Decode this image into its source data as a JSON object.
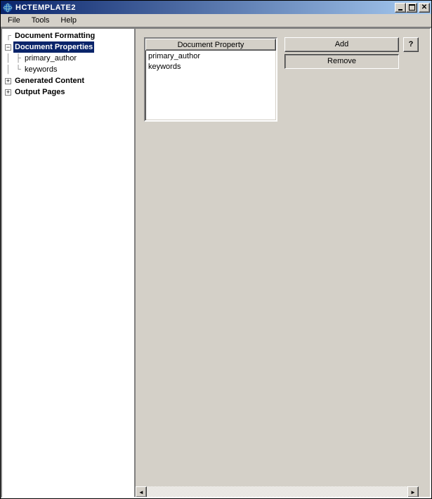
{
  "window": {
    "title": "HCTEMPLATE2"
  },
  "menubar": {
    "file": "File",
    "tools": "Tools",
    "help": "Help"
  },
  "tree": {
    "root1": "Document Formatting",
    "root2": "Document Properties",
    "child2a": "primary_author",
    "child2b": "keywords",
    "root3": "Generated Content",
    "root4": "Output Pages"
  },
  "list": {
    "header": "Document Property",
    "rows": [
      "primary_author",
      "keywords"
    ]
  },
  "buttons": {
    "add": "Add",
    "remove": "Remove",
    "help": "?"
  },
  "expander": {
    "minus": "−",
    "plus": "+"
  },
  "arrows": {
    "left": "◄",
    "right": "►"
  }
}
